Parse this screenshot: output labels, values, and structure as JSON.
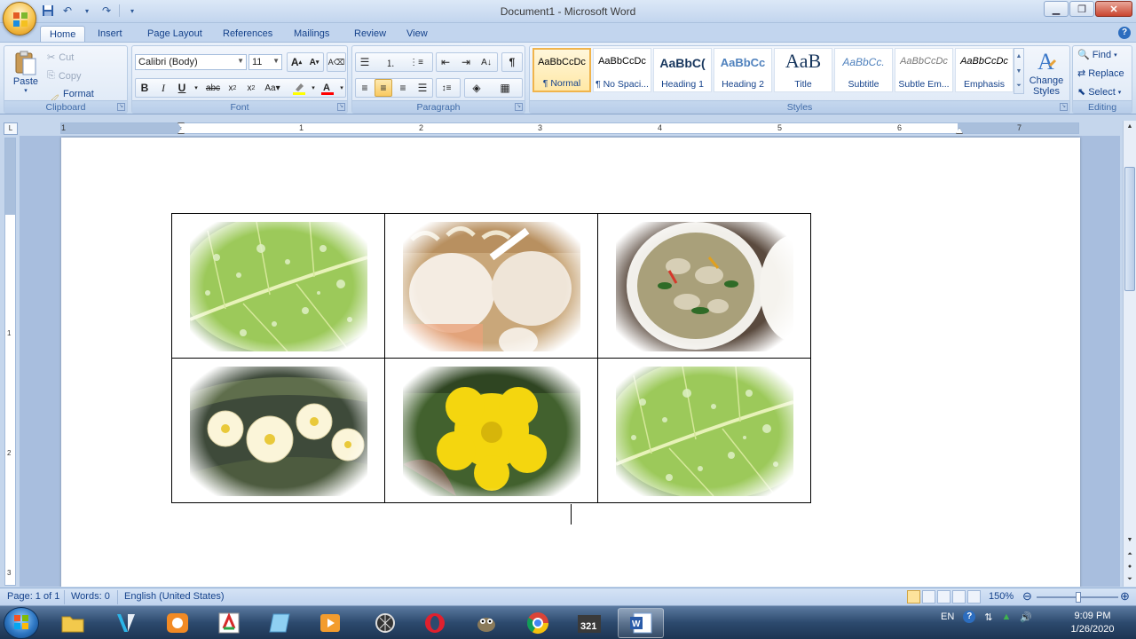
{
  "window": {
    "title": "Document1 - Microsoft Word"
  },
  "tabs": [
    "Home",
    "Insert",
    "Page Layout",
    "References",
    "Mailings",
    "Review",
    "View"
  ],
  "clipboard": {
    "paste_label": "Paste",
    "cut_label": "Cut",
    "copy_label": "Copy",
    "format_painter_label": "Format Painter",
    "group_label": "Clipboard"
  },
  "font": {
    "font_name": "Calibri (Body)",
    "font_size": "11",
    "group_label": "Font"
  },
  "paragraph": {
    "group_label": "Paragraph"
  },
  "styles": {
    "group_label": "Styles",
    "items": [
      {
        "sample": "AaBbCcDc",
        "name": "¶ Normal"
      },
      {
        "sample": "AaBbCcDc",
        "name": "¶ No Spaci..."
      },
      {
        "sample": "AaBbC(",
        "name": "Heading 1"
      },
      {
        "sample": "AaBbCc",
        "name": "Heading 2"
      },
      {
        "sample": "AaB",
        "name": "Title"
      },
      {
        "sample": "AaBbCc.",
        "name": "Subtitle"
      },
      {
        "sample": "AaBbCcDc",
        "name": "Subtle Em..."
      },
      {
        "sample": "AaBbCcDc",
        "name": "Emphasis"
      }
    ],
    "change_styles_label": "Change Styles"
  },
  "editing": {
    "find_label": "Find",
    "replace_label": "Replace",
    "select_label": "Select",
    "group_label": "Editing"
  },
  "ruler": {
    "h_numbers": [
      "1",
      "1",
      "2",
      "3",
      "4",
      "5",
      "6",
      "7"
    ],
    "v_numbers": [
      "1",
      "1",
      "2",
      "3"
    ]
  },
  "statusbar": {
    "page": "Page: 1 of 1",
    "words": "Words: 0",
    "language": "English (United States)",
    "zoom": "150%"
  },
  "taskbar": {
    "lang": "EN",
    "time": "9:09 PM",
    "date": "1/26/2020"
  },
  "colors": {
    "ribbon_text": "#15428b",
    "highlight": "#ffff00",
    "font_color": "#ff0000"
  }
}
